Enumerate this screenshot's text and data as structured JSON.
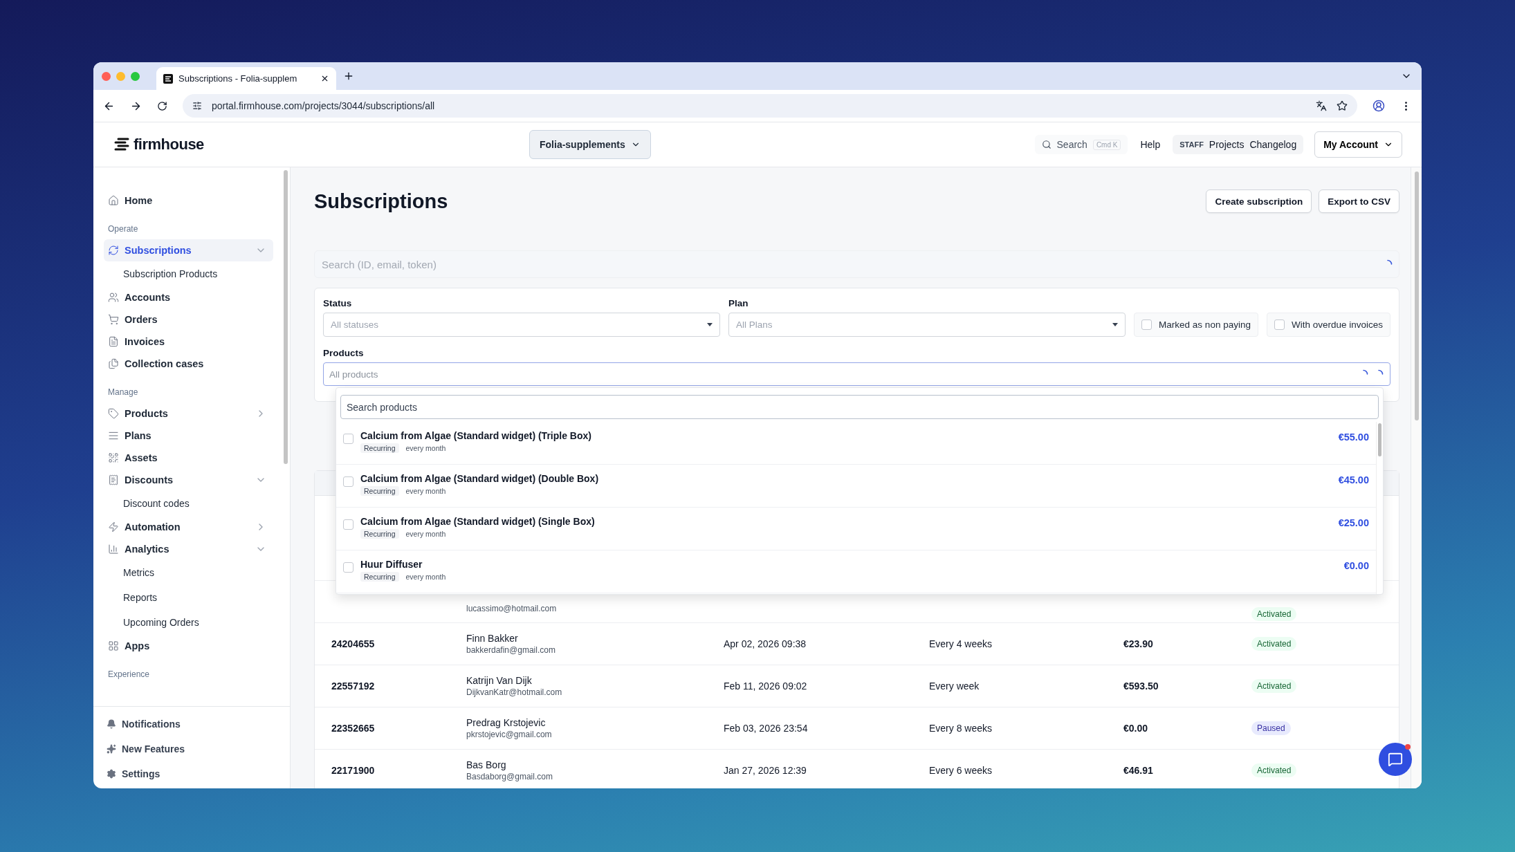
{
  "browser": {
    "tab_title": "Subscriptions - Folia-supplem",
    "url": "portal.firmhouse.com/projects/3044/subscriptions/all"
  },
  "header": {
    "logo": "firmhouse",
    "project": "Folia-supplements",
    "search": {
      "label": "Search",
      "shortcut": "Cmd K"
    },
    "help": "Help",
    "staff": "STAFF",
    "links": [
      "Projects",
      "Changelog"
    ],
    "account": "My Account"
  },
  "sidebar": {
    "sections": [
      {
        "items": [
          {
            "label": "Home",
            "selected": false
          }
        ]
      },
      {
        "heading": "Operate",
        "items": [
          {
            "label": "Subscriptions",
            "selected": true,
            "expanded": true,
            "children": [
              {
                "label": "Subscription Products"
              }
            ]
          },
          {
            "label": "Accounts",
            "selected": false
          },
          {
            "label": "Orders",
            "selected": false
          },
          {
            "label": "Invoices",
            "selected": false
          },
          {
            "label": "Collection cases",
            "selected": false
          }
        ]
      },
      {
        "heading": "Manage",
        "items": [
          {
            "label": "Products",
            "selected": false,
            "expanded": false
          },
          {
            "label": "Plans",
            "selected": false
          },
          {
            "label": "Assets",
            "selected": false
          },
          {
            "label": "Discounts",
            "selected": false,
            "expanded": true,
            "children": [
              {
                "label": "Discount codes"
              }
            ]
          },
          {
            "label": "Automation",
            "selected": false,
            "expanded": false
          },
          {
            "label": "Analytics",
            "selected": false,
            "expanded": true,
            "children": [
              {
                "label": "Metrics"
              },
              {
                "label": "Reports"
              },
              {
                "label": "Upcoming Orders"
              }
            ]
          },
          {
            "label": "Apps",
            "selected": false
          }
        ]
      },
      {
        "heading": "Experience"
      }
    ],
    "bottom": [
      "Notifications",
      "New Features",
      "Settings"
    ]
  },
  "page": {
    "title": "Subscriptions",
    "buttons": [
      "Create subscription",
      "Export to CSV"
    ],
    "search": {
      "placeholder": "Search (ID, email, token)"
    }
  },
  "filters": {
    "selects": [
      {
        "label": "Status",
        "placeholder": "All statuses"
      },
      {
        "label": "Plan",
        "placeholder": "All Plans"
      }
    ],
    "checkboxes": [
      {
        "label": "Marked as non paying",
        "checked": false
      },
      {
        "label": "With overdue invoices",
        "checked": false
      }
    ],
    "products": {
      "label": "Products",
      "placeholder": "All products"
    }
  },
  "product_dropdown": {
    "search": {
      "placeholder": "Search products"
    },
    "items": [
      {
        "name": "Calcium from Algae (Standard widget) (Triple Box)",
        "type": "Recurring",
        "interval": "every month",
        "price": "€55.00",
        "checked": false
      },
      {
        "name": "Calcium from Algae (Standard widget) (Double Box)",
        "type": "Recurring",
        "interval": "every month",
        "price": "€45.00",
        "checked": false
      },
      {
        "name": "Calcium from Algae (Standard widget) (Single Box)",
        "type": "Recurring",
        "interval": "every month",
        "price": "€25.00",
        "checked": false
      },
      {
        "name": "Huur Diffuser",
        "type": "Recurring",
        "interval": "every month",
        "price": "€0.00",
        "checked": false
      }
    ]
  },
  "table": {
    "rows": [
      {
        "email": "lucassimo@hotmail.com",
        "status": "Activated",
        "kind": "activated"
      },
      {
        "id": "24204655",
        "name": "Finn Bakker",
        "email": "bakkerdafin@gmail.com",
        "date": "Apr 02, 2026 09:38",
        "frequency": "Every 4 weeks",
        "amount": "€23.90",
        "status": "Activated",
        "kind": "activated"
      },
      {
        "id": "22557192",
        "name": "Katrijn Van Dijk",
        "email": "DijkvanKatr@hotmail.com",
        "date": "Feb 11, 2026 09:02",
        "frequency": "Every week",
        "amount": "€593.50",
        "status": "Activated",
        "kind": "activated"
      },
      {
        "id": "22352665",
        "name": "Predrag Krstojevic",
        "email": "pkrstojevic@gmail.com",
        "date": "Feb 03, 2026 23:54",
        "frequency": "Every 8 weeks",
        "amount": "€0.00",
        "status": "Paused",
        "kind": "paused"
      },
      {
        "id": "22171900",
        "name": "Bas Borg",
        "email": "Basdaborg@gmail.com",
        "date": "Jan 27, 2026 12:39",
        "frequency": "Every 6 weeks",
        "amount": "€46.91",
        "status": "Activated",
        "kind": "activated"
      }
    ]
  }
}
